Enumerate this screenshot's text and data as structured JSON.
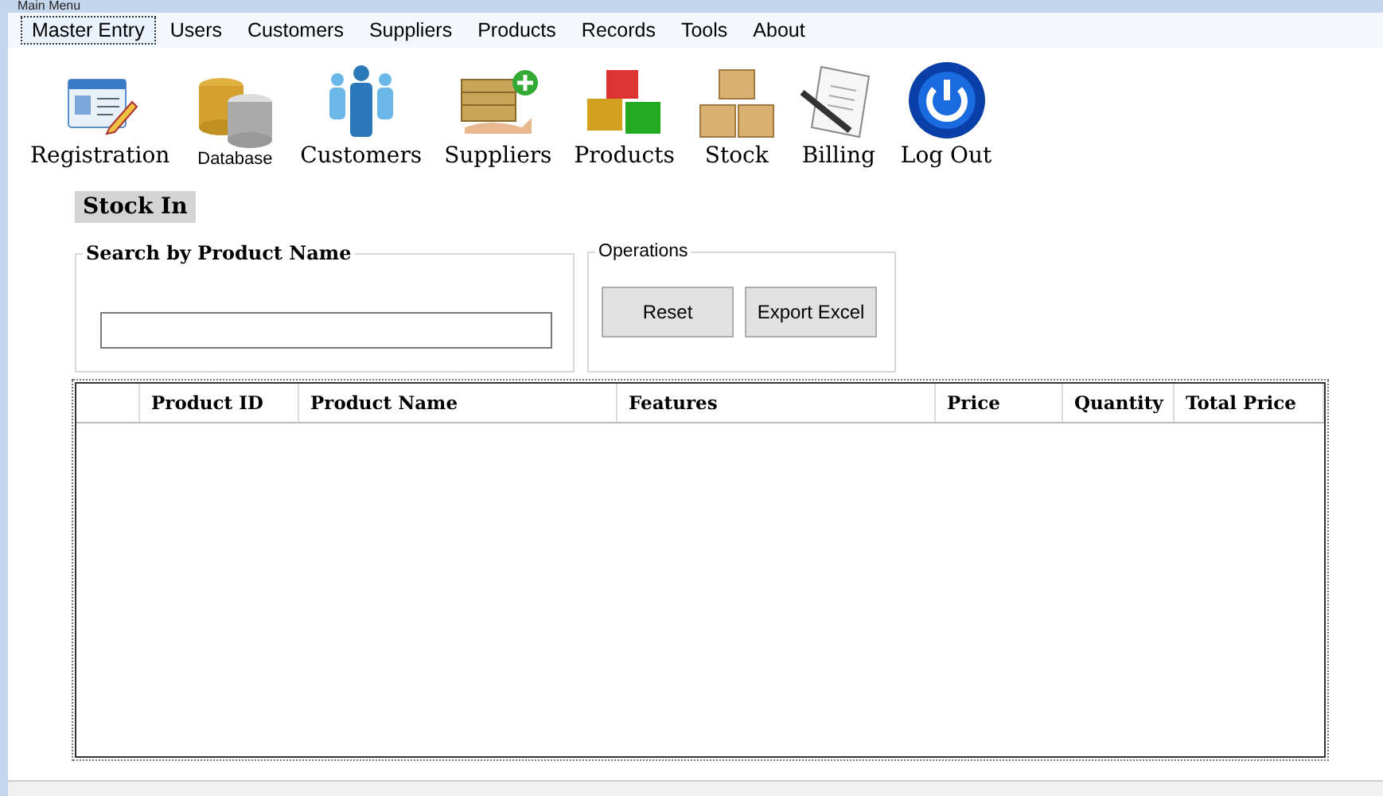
{
  "window": {
    "title": "Main Menu"
  },
  "menu": [
    {
      "label": "Master Entry",
      "selected": true
    },
    {
      "label": "Users",
      "selected": false
    },
    {
      "label": "Customers",
      "selected": false
    },
    {
      "label": "Suppliers",
      "selected": false
    },
    {
      "label": "Products",
      "selected": false
    },
    {
      "label": "Records",
      "selected": false
    },
    {
      "label": "Tools",
      "selected": false
    },
    {
      "label": "About",
      "selected": false
    }
  ],
  "toolbar": [
    {
      "label": "Registration",
      "kind": "registration"
    },
    {
      "label": "Database",
      "kind": "database"
    },
    {
      "label": "Customers",
      "kind": "customers"
    },
    {
      "label": "Suppliers",
      "kind": "suppliers"
    },
    {
      "label": "Products",
      "kind": "products"
    },
    {
      "label": "Stock",
      "kind": "stock"
    },
    {
      "label": "Billing",
      "kind": "billing"
    },
    {
      "label": "Log Out",
      "kind": "logout"
    }
  ],
  "section_title": "Stock In",
  "search_group": {
    "title": "Search by Product Name"
  },
  "operations": {
    "title": "Operations",
    "buttons": [
      "Reset",
      "Export Excel"
    ]
  },
  "table": {
    "columns": [
      "Product ID",
      "Product Name",
      "Features",
      "Price",
      "Quantity",
      "Total Price"
    ]
  }
}
